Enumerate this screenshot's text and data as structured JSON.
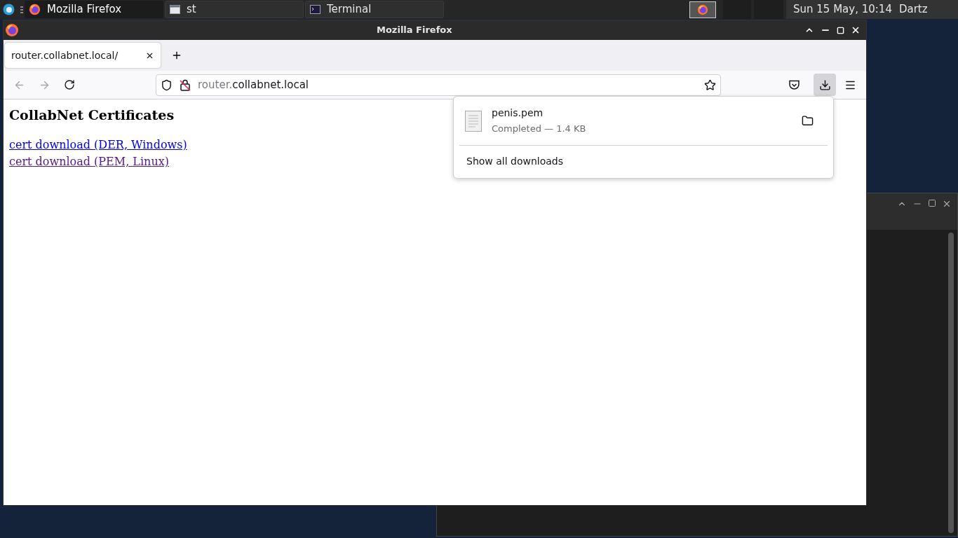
{
  "taskbar": {
    "tasks": [
      {
        "label": "Mozilla Firefox",
        "selected": true,
        "kind": "browser"
      },
      {
        "label": "st",
        "selected": false,
        "kind": "window"
      },
      {
        "label": "Terminal",
        "selected": false,
        "kind": "terminal"
      }
    ],
    "clock": "Sun 15 May, 10:14",
    "user": "Dartz"
  },
  "window": {
    "title": "Mozilla Firefox"
  },
  "tabs": [
    {
      "label": "router.collabnet.local/",
      "selected": true
    }
  ],
  "address_bar": {
    "host_prefix": "router.",
    "domain": "collabnet.local"
  },
  "page": {
    "heading": "CollabNet Certificates",
    "links": [
      {
        "label": "cert download (DER, Windows)",
        "visited": false
      },
      {
        "label": "cert download (PEM, Linux)",
        "visited": true
      }
    ]
  },
  "downloads_panel": {
    "open": true,
    "items": [
      {
        "filename": "penis.pem",
        "status": "Completed — 1.4 KB"
      }
    ],
    "footer": "Show all downloads"
  }
}
